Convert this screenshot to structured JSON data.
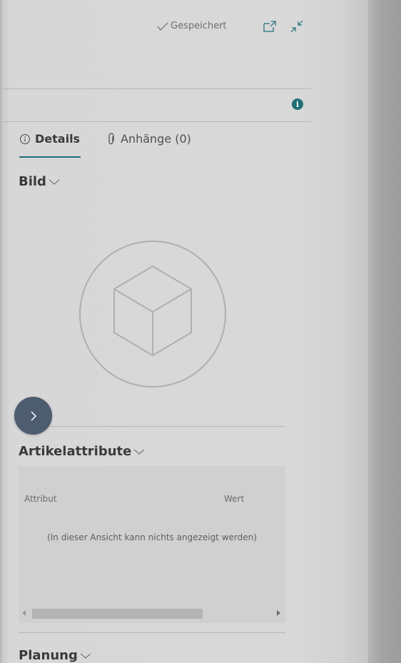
{
  "header": {
    "saved_status": "Gespeichert",
    "popout_icon": "popout-icon",
    "collapse_icon": "collapse-icon"
  },
  "info_icon": {
    "glyph": "i"
  },
  "tabs": [
    {
      "label": "Details",
      "icon": "info-circle-icon",
      "active": true
    },
    {
      "label": "Anhänge (0)",
      "icon": "paperclip-icon",
      "active": false
    }
  ],
  "sections": {
    "picture": {
      "title": "Bild"
    },
    "item_attributes": {
      "title": "Artikelattribute",
      "columns": [
        "Attribut",
        "Wert"
      ],
      "empty_message": "(In dieser Ansicht kann nichts angezeigt werden)"
    },
    "planning": {
      "title": "Planung"
    }
  },
  "colors": {
    "accent": "#1f6f77",
    "fab": "#4e5c70",
    "panel": "#d8d8d8"
  }
}
